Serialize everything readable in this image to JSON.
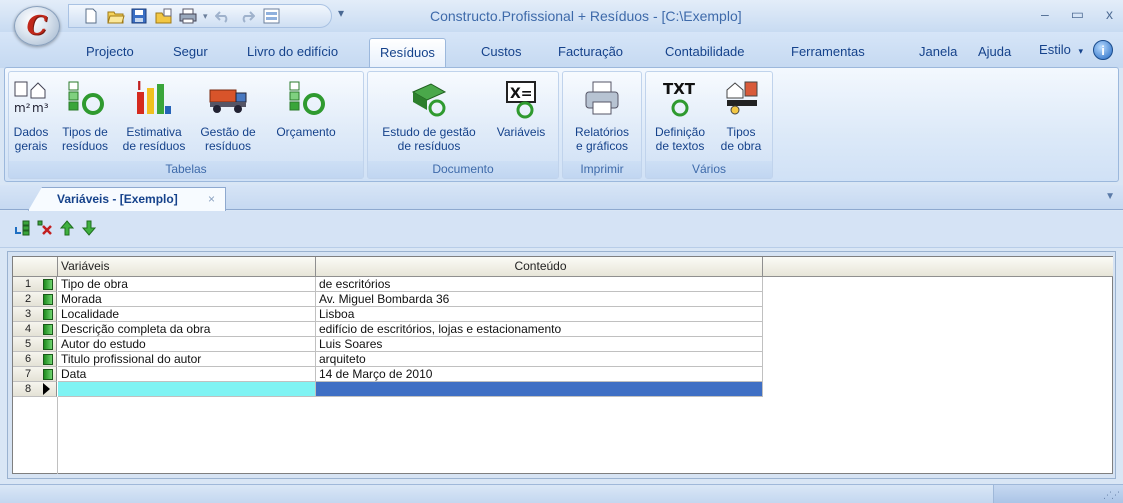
{
  "app": {
    "orb_letter": "C",
    "window_title": "Constructo.Profissional + Resíduos - [C:\\Exemplo]",
    "quick_access": [
      "new-icon",
      "open-icon",
      "save-icon",
      "open-folder-icon",
      "print-icon",
      "undo-icon",
      "redo-icon",
      "layout-icon"
    ],
    "controls": {
      "minimize": "–",
      "maximize": "▭",
      "close": "x"
    }
  },
  "menu_tabs": [
    {
      "label": "Projecto"
    },
    {
      "label": "Segur"
    },
    {
      "label": "Livro do edifício"
    },
    {
      "label": "Resíduos",
      "active": true
    },
    {
      "label": "Custos"
    },
    {
      "label": "Facturação"
    },
    {
      "label": "Contabilidade"
    },
    {
      "label": "Ferramentas"
    },
    {
      "label": "Janela"
    },
    {
      "label": "Ajuda"
    }
  ],
  "style_menu": "Estilo",
  "ribbon": {
    "groups": [
      {
        "label": "Tabelas",
        "buttons": [
          {
            "label": "Dados\ngerais",
            "icon": "house-area-icon"
          },
          {
            "label": "Tipos de\nresíduos",
            "icon": "recycle-blocks-icon"
          },
          {
            "label": "Estimativa\nde resíduos",
            "icon": "estimate-bars-icon"
          },
          {
            "label": "Gestão de\nresíduos",
            "icon": "truck-icon"
          },
          {
            "label": "Orçamento",
            "icon": "recycle-budget-icon"
          }
        ]
      },
      {
        "label": "Documento",
        "buttons": [
          {
            "label": "Estudo de gestão\nde resíduos",
            "icon": "recycle-book-icon"
          },
          {
            "label": "Variáveis",
            "icon": "variables-icon"
          }
        ]
      },
      {
        "label": "Imprimir",
        "buttons": [
          {
            "label": "Relatórios\ne gráficos",
            "icon": "printer-icon"
          }
        ]
      },
      {
        "label": "Vários",
        "buttons": [
          {
            "label": "Definição\nde textos",
            "icon": "txt-recycle-icon"
          },
          {
            "label": "Tipos\nde obra",
            "icon": "building-type-icon"
          }
        ]
      }
    ]
  },
  "document_tab": {
    "label": "Variáveis - [Exemplo]",
    "close": "×"
  },
  "toolbar": [
    "insert-row-icon",
    "delete-row-icon",
    "move-up-icon",
    "move-down-icon"
  ],
  "grid": {
    "columns": [
      "Variáveis",
      "Conteúdo"
    ],
    "rows": [
      {
        "num": "1",
        "variavel": "Tipo de obra",
        "conteudo": "de escritórios"
      },
      {
        "num": "2",
        "variavel": "Morada",
        "conteudo": "Av. Miguel Bombarda 36"
      },
      {
        "num": "3",
        "variavel": "Localidade",
        "conteudo": "Lisboa"
      },
      {
        "num": "4",
        "variavel": "Descrição completa da obra",
        "conteudo": "edifício de escritórios, lojas e estacionamento"
      },
      {
        "num": "5",
        "variavel": "Autor do estudo",
        "conteudo": "Luis Soares"
      },
      {
        "num": "6",
        "variavel": "Titulo profissional do autor",
        "conteudo": "arquiteto"
      },
      {
        "num": "7",
        "variavel": "Data",
        "conteudo": "14 de Março de 2010"
      },
      {
        "num": "8",
        "variavel": "",
        "conteudo": "",
        "new_row": true
      }
    ]
  },
  "colors": {
    "accent_text": "#15428b",
    "new_row_cell": "#7ff3f3",
    "selected_cell": "#3f6fc4"
  }
}
